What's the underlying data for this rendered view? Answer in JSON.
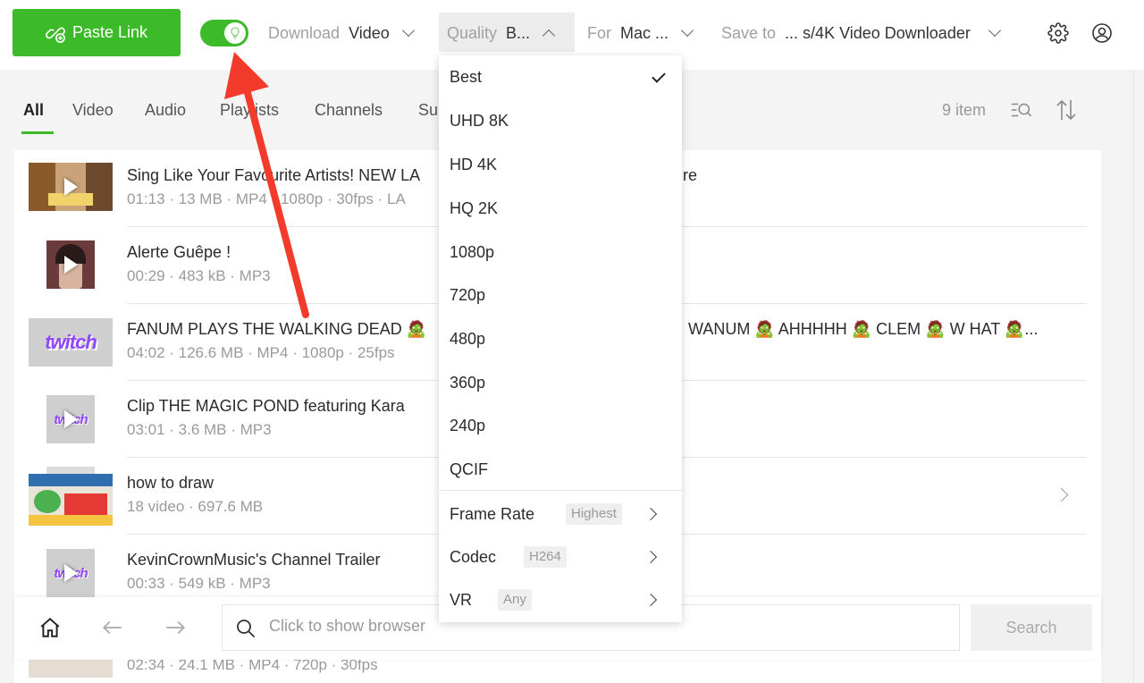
{
  "toolbar": {
    "paste_link": "Paste Link",
    "download_label": "Download",
    "download_value": "Video",
    "quality_label": "Quality",
    "quality_value": "B...",
    "for_label": "For",
    "for_value": "Mac ...",
    "save_label": "Save to",
    "save_value": "... s/4K Video Downloader",
    "smart_mode_on": true,
    "icons": [
      "link-add-icon",
      "bulb-icon",
      "gear-icon",
      "account-icon"
    ]
  },
  "tabs": [
    {
      "label": "All",
      "active": true
    },
    {
      "label": "Video"
    },
    {
      "label": "Audio"
    },
    {
      "label": "Playlists"
    },
    {
      "label": "Channels"
    },
    {
      "label": "Su"
    }
  ],
  "items_count": "9 item",
  "items": [
    {
      "title": "Sing Like Your Favourite Artists! NEW LA",
      "title_tail": "re",
      "meta": "01:13 · 13 MB · MP4 · 1080p · 30fps · LA",
      "thumb": "singer"
    },
    {
      "title": "Alerte Guêpe !",
      "meta": "00:29 · 483 kB · MP3",
      "thumb": "portrait"
    },
    {
      "title": "FANUM PLAYS THE WALKING DEAD 🧟",
      "title_tail": "WANUM 🧟 AHHHHH 🧟 CLEM 🧟 W HAT 🧟...",
      "meta": "04:02 · 126.6 MB · MP4 · 1080p · 25fps",
      "thumb": "twitch"
    },
    {
      "title": "Clip THE MAGIC POND featuring Kara",
      "meta": "03:01 · 3.6 MB · MP3",
      "thumb": "twitch"
    },
    {
      "title": "how to draw",
      "meta": "18 video · 697.6 MB",
      "thumb": "playlist"
    },
    {
      "title": "KevinCrownMusic's Channel Trailer",
      "meta": "00:33 · 549 kB · MP3",
      "thumb": "twitch"
    }
  ],
  "peek_meta": "02:34 · 24.1 MB · MP4 · 720p · 30fps",
  "twitch_word": "twitch",
  "quality_menu": {
    "options": [
      "Best",
      "UHD 8K",
      "HD 4K",
      "HQ 2K",
      "1080p",
      "720p",
      "480p",
      "360p",
      "240p",
      "QCIF"
    ],
    "selected": "Best",
    "frame_rate_label": "Frame Rate",
    "frame_rate_value": "Highest",
    "codec_label": "Codec",
    "codec_value": "H264",
    "vr_label": "VR",
    "vr_value": "Any"
  },
  "browser_bar": {
    "placeholder": "Click to show browser",
    "search_label": "Search"
  },
  "colors": {
    "accent": "#3dba2a",
    "annotation_arrow": "#f23b2a",
    "twitch": "#9146ff"
  }
}
